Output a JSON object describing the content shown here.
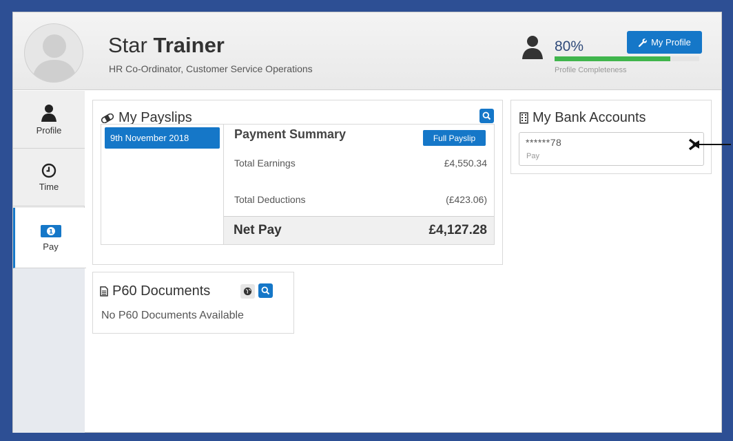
{
  "header": {
    "first_name": "Star",
    "last_name": "Trainer",
    "role": "HR Co-Ordinator, Customer Service Operations",
    "profile_percent_text": "80%",
    "profile_percent": 80,
    "profile_label": "Profile Completeness",
    "my_profile_button": "My Profile"
  },
  "sidebar": {
    "items": [
      {
        "label": "Profile",
        "icon": "person-icon"
      },
      {
        "label": "Time",
        "icon": "clock-icon"
      },
      {
        "label": "Pay",
        "icon": "banknote-icon",
        "active": true
      }
    ]
  },
  "payslips": {
    "title": "My Payslips",
    "dates": [
      "9th November 2018"
    ],
    "summary_title": "Payment Summary",
    "full_payslip_button": "Full Payslip",
    "rows": [
      {
        "label": "Total Earnings",
        "value": "£4,550.34"
      },
      {
        "label": "Total Deductions",
        "value": "(£423.06)"
      }
    ],
    "net_label": "Net Pay",
    "net_value": "£4,127.28"
  },
  "bank": {
    "title": "My Bank Accounts",
    "accounts": [
      {
        "number": "******78",
        "type": "Pay"
      }
    ]
  },
  "p60": {
    "title": "P60 Documents",
    "empty_text": "No P60 Documents Available"
  },
  "colors": {
    "accent": "#1577c8",
    "progress": "#3fb54c",
    "frame": "#2d4f94"
  }
}
